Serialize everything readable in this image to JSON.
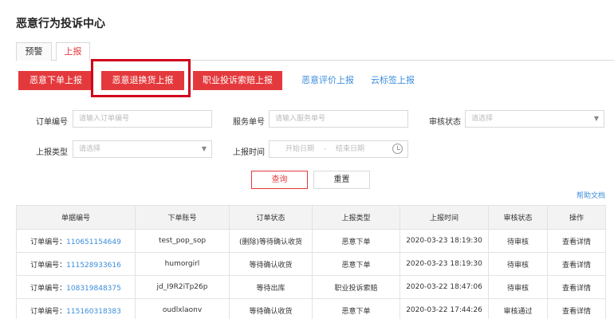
{
  "page_title": "恶意行为投诉中心",
  "tabs": [
    "预警",
    "上报"
  ],
  "action_buttons": [
    "恶意下单上报",
    "恶意退换货上报",
    "职业投诉索赔上报"
  ],
  "link_buttons": [
    "恶意评价上报",
    "云标签上报"
  ],
  "filters": {
    "order_no": {
      "label": "订单编号",
      "placeholder": "请输入订单编号"
    },
    "service_no": {
      "label": "服务单号",
      "placeholder": "请输入服务单号"
    },
    "review_status": {
      "label": "审核状态",
      "placeholder": "请选择"
    },
    "report_type": {
      "label": "上报类型",
      "placeholder": "请选择"
    },
    "report_time": {
      "label": "上报时间",
      "start": "开始日期",
      "sep": "-",
      "end": "结束日期"
    }
  },
  "query_label": "查询",
  "reset_label": "重置",
  "help_label": "帮助文档",
  "table": {
    "headers": [
      "单据编号",
      "下单账号",
      "订单状态",
      "上报类型",
      "上报时间",
      "审核状态",
      "操作"
    ],
    "order_prefix": "订单编号：",
    "rows": [
      {
        "order_no": "110651154649",
        "account": "test_pop_sop",
        "status": "(删除)等待确认收货",
        "type": "恶意下单",
        "time": "2020-03-23 18:19:30",
        "review": "待审核",
        "action": "查看详情"
      },
      {
        "order_no": "111528933616",
        "account": "humorgirl",
        "status": "等待确认收货",
        "type": "恶意下单",
        "time": "2020-03-23 18:19:30",
        "review": "待审核",
        "action": "查看详情"
      },
      {
        "order_no": "108319848375",
        "account": "jd_I9R2iTp26p",
        "status": "等待出库",
        "type": "职业投诉索赔",
        "time": "2020-03-22 18:47:06",
        "review": "待审核",
        "action": "查看详情"
      },
      {
        "order_no": "115160318383",
        "account": "oudlxlaonv",
        "status": "等待确认收货",
        "type": "恶意下单",
        "time": "2020-03-22 17:44:26",
        "review": "审核通过",
        "action": "查看详情"
      }
    ]
  }
}
